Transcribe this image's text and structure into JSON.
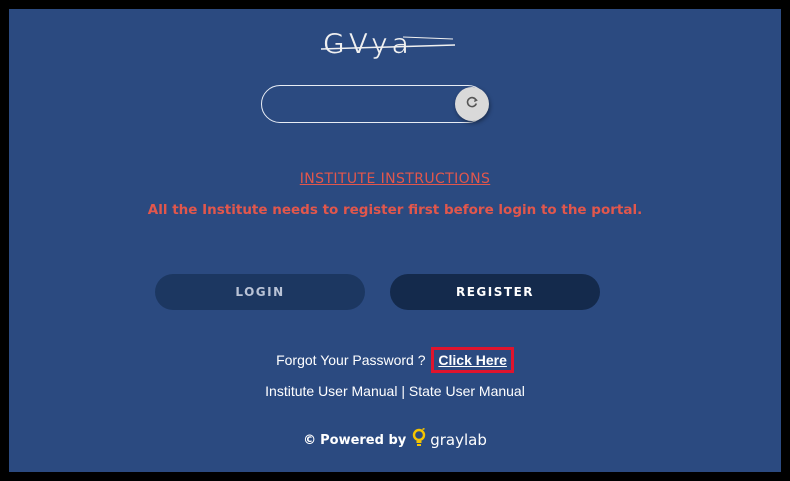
{
  "captcha": {
    "text": "GVya",
    "input_value": "",
    "input_placeholder": ""
  },
  "instructions": {
    "title": "INSTITUTE INSTRUCTIONS",
    "text": "All the Institute needs to register first before login to the portal."
  },
  "buttons": {
    "login_label": "LOGIN",
    "register_label": "REGISTER"
  },
  "forgot": {
    "prompt": "Forgot Your Password ?",
    "link_label": "Click Here"
  },
  "manuals": {
    "institute_label": "Institute User Manual",
    "separator": "|",
    "state_label": "State User Manual"
  },
  "footer": {
    "copyright_symbol": "©",
    "powered_by": "Powered by",
    "brand": "graylab"
  },
  "colors": {
    "panel_bg": "#2b4a80",
    "instruction_text": "#e2574c",
    "highlight_box": "#e0142d",
    "brand_bulb": "#f5c400"
  },
  "icons": {
    "refresh": "refresh-icon",
    "bulb": "bulb-icon"
  }
}
